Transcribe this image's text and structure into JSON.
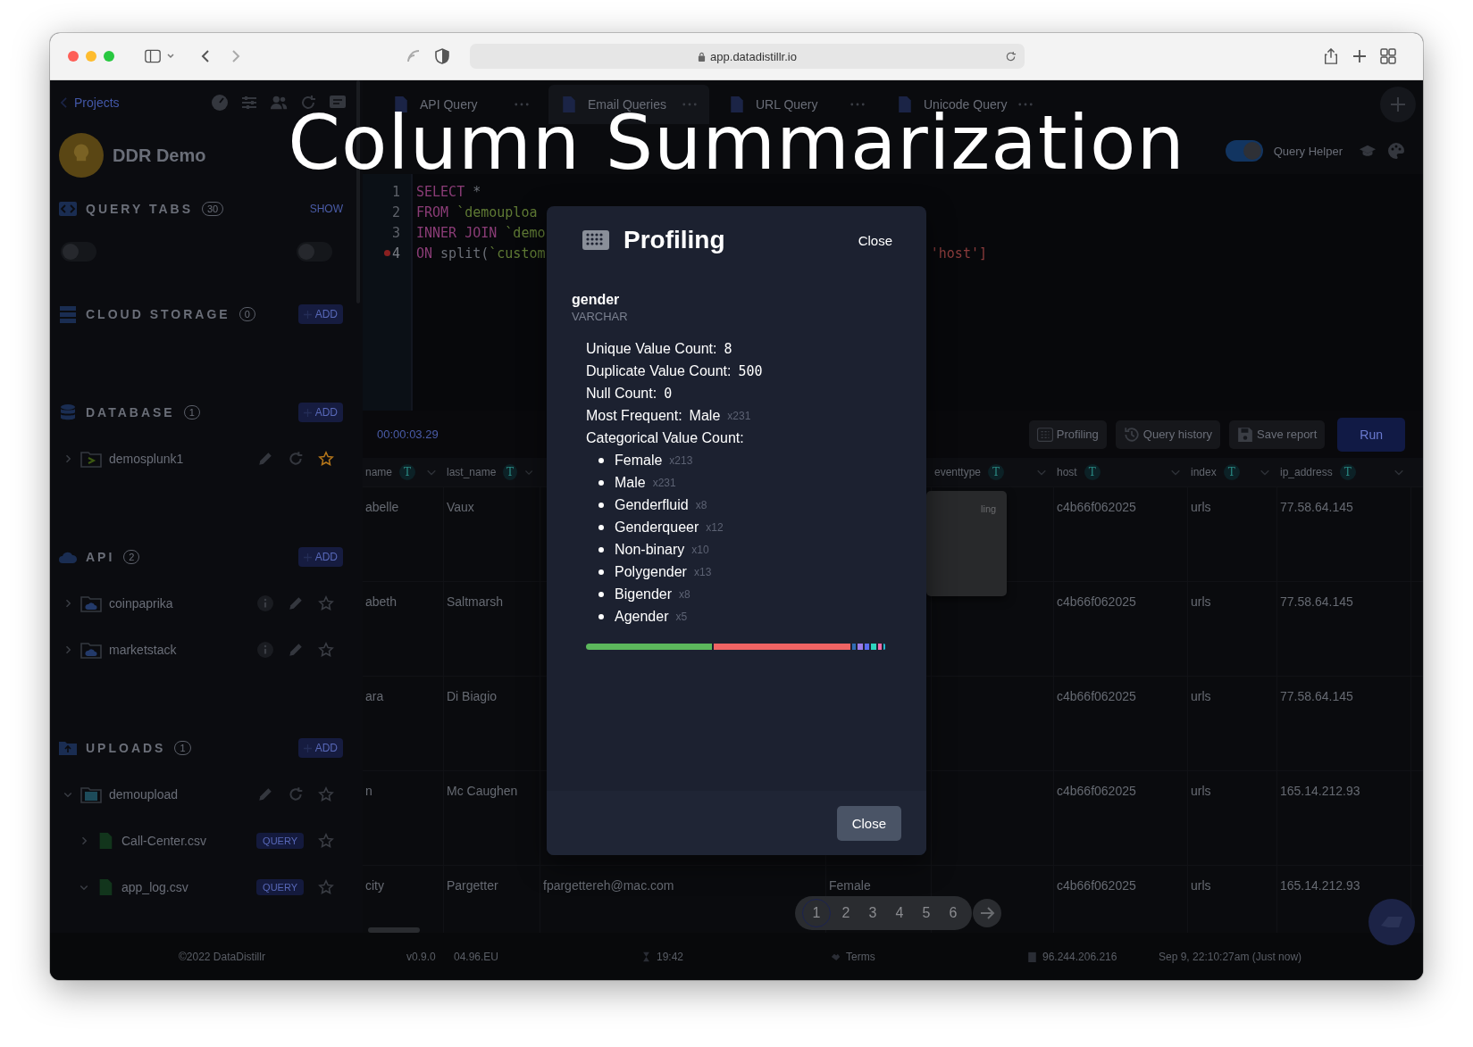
{
  "browser": {
    "url": "app.datadistillr.io"
  },
  "overlay_title": "Column Summarization",
  "sidebar": {
    "back_link": "Projects",
    "project": "DDR Demo",
    "sections": [
      {
        "title": "QUERY TABS",
        "count": "30",
        "action": "SHOW",
        "kind": "toggles",
        "toggles": [
          {
            "on": false
          },
          {
            "on": false
          }
        ]
      },
      {
        "title": "CLOUD STORAGE",
        "count": "0",
        "action": "ADD",
        "kind": "list"
      },
      {
        "title": "DATABASE",
        "count": "1",
        "action": "ADD",
        "kind": "list",
        "items": [
          {
            "name": "demosplunk1",
            "kind": "database",
            "expanded": false,
            "starred": true
          }
        ]
      },
      {
        "title": "API",
        "count": "2",
        "action": "ADD",
        "kind": "list",
        "items": [
          {
            "name": "coinpaprika",
            "kind": "api",
            "expanded": false,
            "starred": false
          },
          {
            "name": "marketstack",
            "kind": "api",
            "expanded": false,
            "starred": false
          }
        ]
      },
      {
        "title": "UPLOADS",
        "count": "1",
        "action": "ADD",
        "kind": "list",
        "items": [
          {
            "name": "demoupload",
            "kind": "folder",
            "expanded": true,
            "starred": false,
            "children": [
              {
                "name": "Call-Center.csv",
                "kind": "file",
                "badge": "QUERY",
                "expanded": false,
                "starred": false
              },
              {
                "name": "app_log.csv",
                "kind": "file",
                "badge": "QUERY",
                "expanded": true,
                "starred": false
              }
            ]
          }
        ]
      }
    ]
  },
  "tabs": [
    {
      "label": "API Query",
      "selected": false
    },
    {
      "label": "Email Queries",
      "selected": true
    },
    {
      "label": "URL Query",
      "selected": false
    },
    {
      "label": "Unicode Query",
      "selected": false
    }
  ],
  "toolbar": {
    "helper_label": "Query Helper",
    "helper_on": true
  },
  "editor": {
    "lines": [
      {
        "number": "1",
        "error": false,
        "tokens": [
          {
            "text": "SELECT",
            "kind": "keyword"
          },
          {
            "text": " *",
            "kind": "plain"
          }
        ]
      },
      {
        "number": "2",
        "error": false,
        "tokens": [
          {
            "text": "FROM",
            "kind": "keyword"
          },
          {
            "text": " `demouploa",
            "kind": "string"
          }
        ]
      },
      {
        "number": "3",
        "error": false,
        "tokens": [
          {
            "text": "INNER JOIN",
            "kind": "keyword"
          },
          {
            "text": " `demo",
            "kind": "string"
          }
        ]
      },
      {
        "number": "4",
        "error": true,
        "tokens": [
          {
            "text": "ON",
            "kind": "keyword"
          },
          {
            "text": " split(",
            "kind": "plain"
          },
          {
            "text": "`custom",
            "kind": "string"
          }
        ],
        "tail": "'host']"
      }
    ]
  },
  "results": {
    "timer": "00:00:03.29",
    "buttons": [
      {
        "label": "Profiling",
        "kind": "profiling"
      },
      {
        "label": "Query history",
        "kind": "history"
      },
      {
        "label": "Save report",
        "kind": "save"
      },
      {
        "label": "Run",
        "kind": "primary"
      }
    ]
  },
  "table": {
    "columns": [
      {
        "label": "name",
        "badge": "T"
      },
      {
        "label": "last_name",
        "badge": "T"
      },
      null,
      null,
      {
        "label": "eventtype",
        "badge": "T"
      },
      {
        "label": "host",
        "badge": "T"
      },
      {
        "label": "index",
        "badge": "T"
      },
      {
        "label": "ip_address",
        "badge": "T"
      }
    ],
    "rows": [
      [
        "abelle",
        "Vaux",
        null,
        null,
        null,
        "c4b66f062025",
        "urls",
        "77.58.64.145"
      ],
      [
        "abeth",
        "Saltmarsh",
        null,
        null,
        null,
        "c4b66f062025",
        "urls",
        "77.58.64.145"
      ],
      [
        "ara",
        "Di Biagio",
        null,
        null,
        null,
        "c4b66f062025",
        "urls",
        "77.58.64.145"
      ],
      [
        "n",
        "Mc Caughen",
        null,
        null,
        null,
        "c4b66f062025",
        "urls",
        "165.14.212.93"
      ],
      [
        "city",
        "Pargetter",
        "fpargettereh@mac.com",
        "Female",
        null,
        "c4b66f062025",
        "urls",
        "165.14.212.93"
      ]
    ]
  },
  "popup_menu": {
    "text": "ling"
  },
  "pagination": {
    "pages": [
      {
        "label": "1",
        "selected": true
      },
      {
        "label": "2",
        "selected": false
      },
      {
        "label": "3",
        "selected": false
      },
      {
        "label": "4",
        "selected": false
      },
      {
        "label": "5",
        "selected": false
      },
      {
        "label": "6",
        "selected": false
      }
    ]
  },
  "footer": [
    {
      "text": "©2022 DataDistillr",
      "kind": "plain"
    },
    {
      "text": "v0.9.0",
      "kind": "plain"
    },
    {
      "text": "04.96.EU",
      "kind": "plain"
    },
    {
      "text": "19:42",
      "kind": "timer"
    },
    {
      "text": "Terms",
      "kind": "terms"
    },
    {
      "text": "96.244.206.216",
      "kind": "ip"
    },
    {
      "text": "Sep 9, 22:10:27am (Just now)",
      "kind": "plain"
    }
  ],
  "modal": {
    "title": "Profiling",
    "close_link": "Close",
    "column_name": "gender",
    "column_type": "VARCHAR",
    "stats": [
      {
        "label": "Unique Value Count:",
        "value": "8",
        "kind": "number"
      },
      {
        "label": "Duplicate Value Count:",
        "value": "500",
        "kind": "number"
      },
      {
        "label": "Null Count:",
        "value": "0",
        "kind": "number"
      },
      {
        "label": "Most Frequent:",
        "value": "Male",
        "count": "x231",
        "kind": "text"
      },
      {
        "label": "Categorical Value Count:",
        "kind": "list"
      }
    ],
    "categories": [
      {
        "name": "Female",
        "count": "x213",
        "color": "#5cb85c"
      },
      {
        "name": "Male",
        "count": "x231",
        "color": "#ef6464"
      },
      {
        "name": "Genderfluid",
        "count": "x8",
        "color": "#2f6db5"
      },
      {
        "name": "Genderqueer",
        "count": "x12",
        "color": "#9b7be8"
      },
      {
        "name": "Non-binary",
        "count": "x10",
        "color": "#5b6cf0"
      },
      {
        "name": "Polygender",
        "count": "x13",
        "color": "#2dd4bf"
      },
      {
        "name": "Bigender",
        "count": "x8",
        "color": "#f06ba8"
      },
      {
        "name": "Agender",
        "count": "x5",
        "color": "#22b8cf"
      }
    ],
    "close_button": "Close"
  }
}
